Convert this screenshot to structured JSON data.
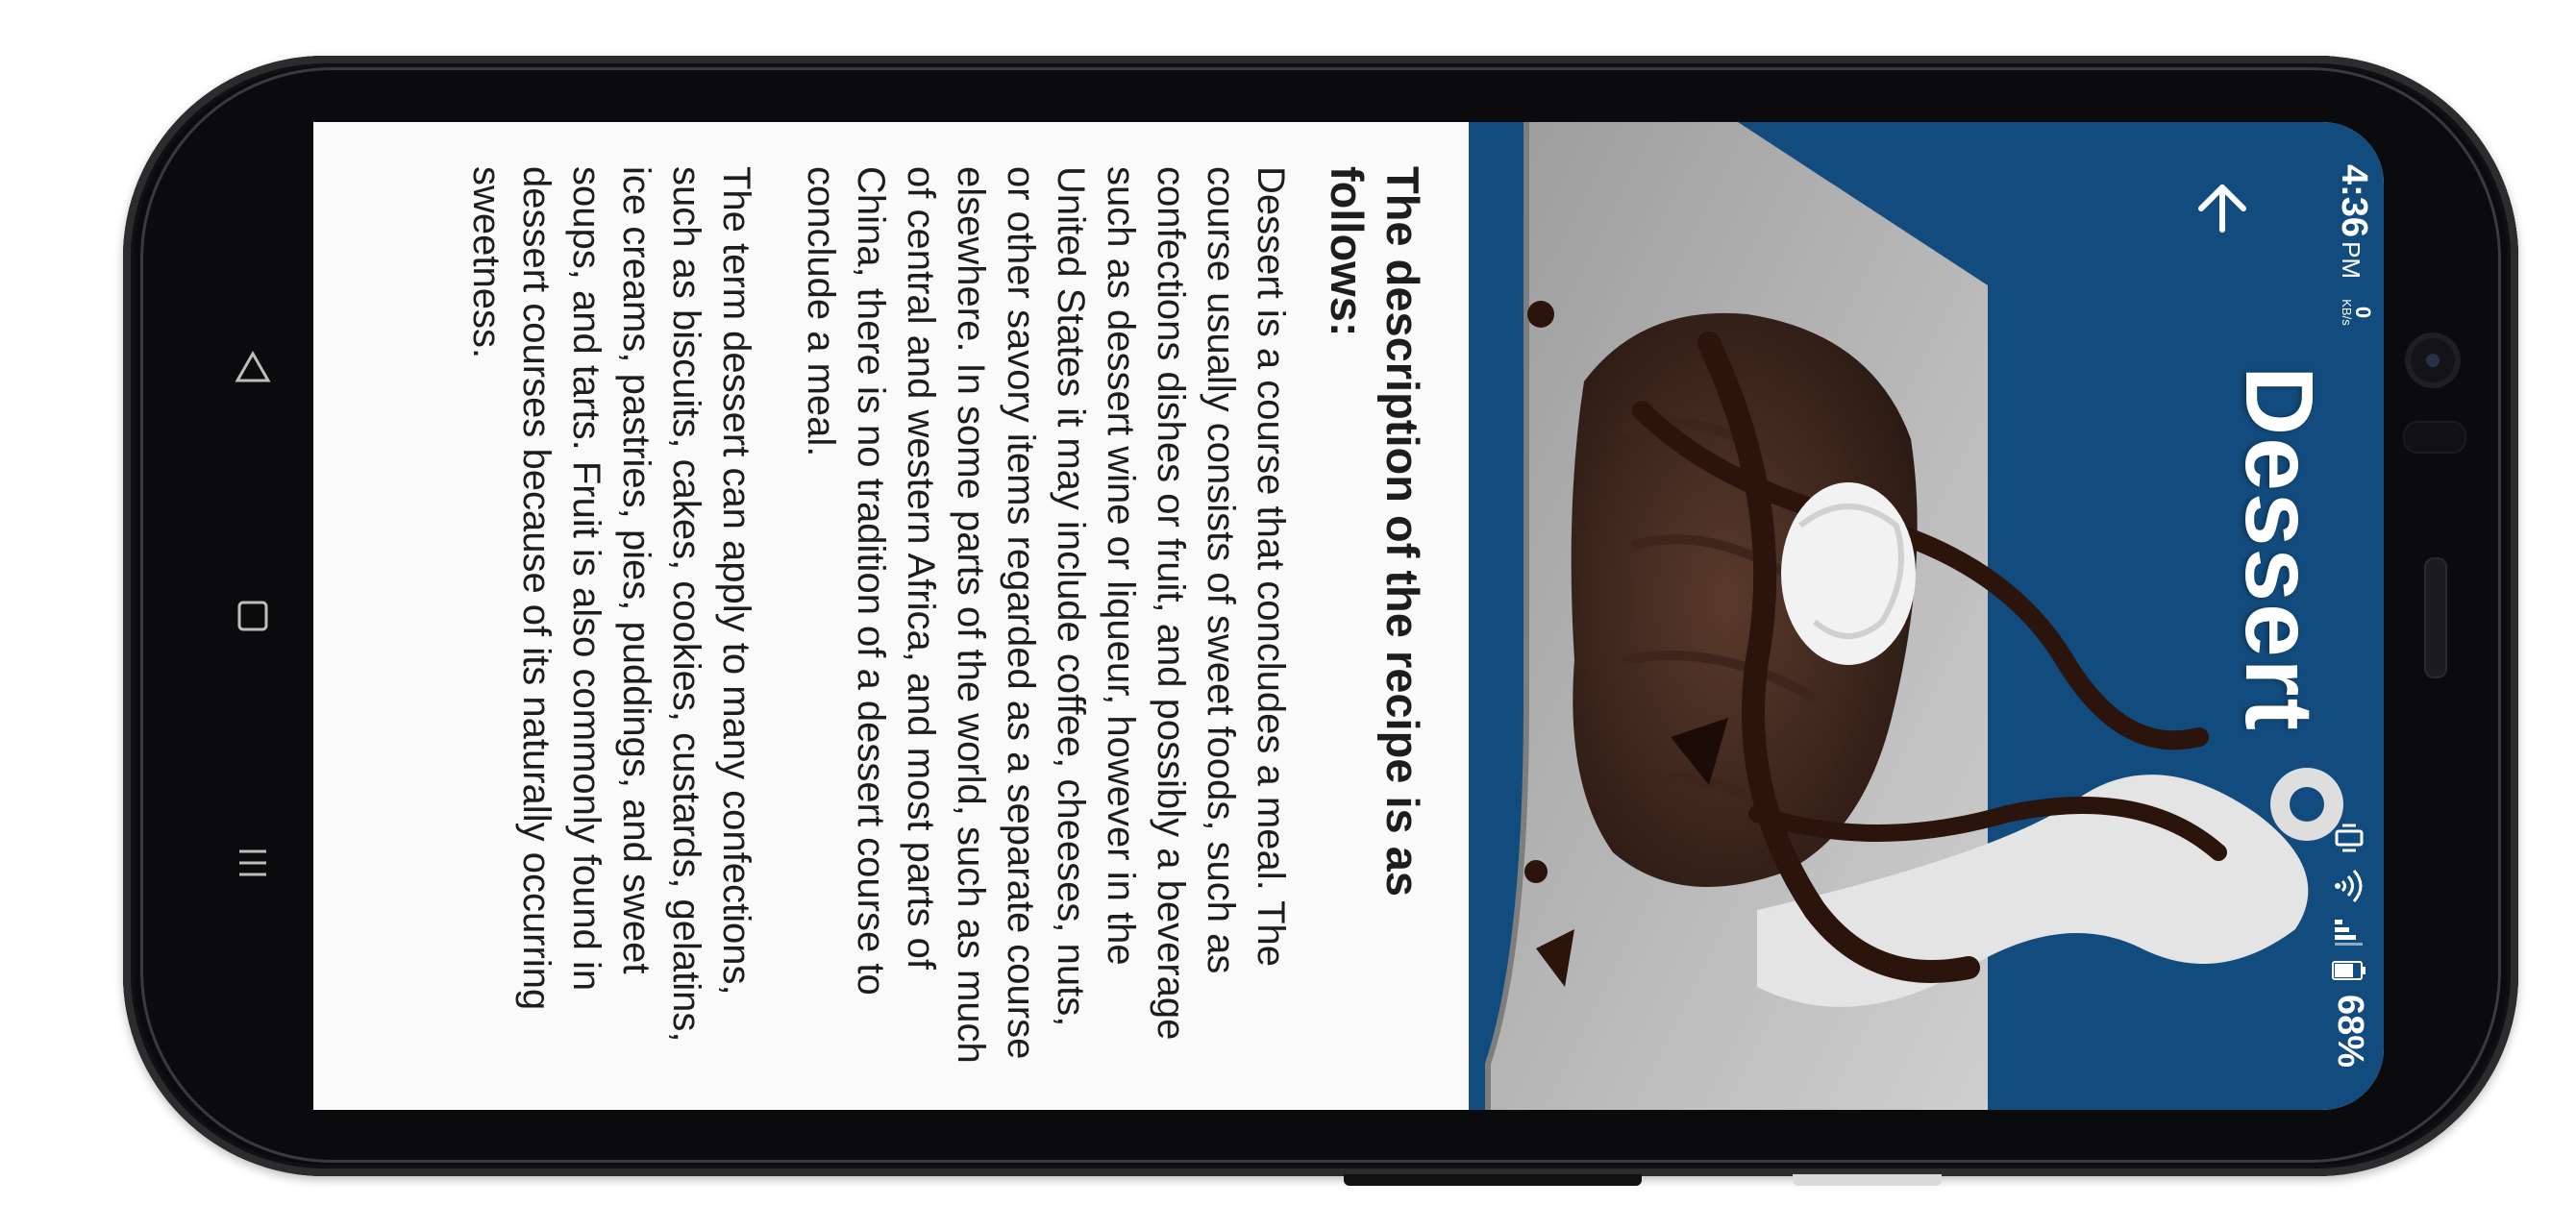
{
  "status_bar": {
    "time": "4:36",
    "ampm": "PM",
    "net_speed": "0",
    "net_unit": "KB/s",
    "battery_percent": "68%",
    "icons": [
      "vibrate-icon",
      "wifi-icon",
      "signal-icon",
      "battery-icon"
    ]
  },
  "header": {
    "title": "Dessert",
    "back_icon": "arrow-back-icon"
  },
  "content": {
    "heading": "The description of the recipe is as follows:",
    "paragraphs": [
      "Dessert is a course that concludes a meal. The course usually consists of sweet foods, such as confections dishes or fruit, and possibly a beverage such as dessert wine or liqueur, however in the United States it may include coffee, cheeses, nuts, or other savory items regarded as a separate course elsewhere. In some parts of the world, such as much of central and western Africa, and most parts of China, there is no tradition of a dessert course to conclude a meal.",
      "The term dessert can apply to many confections, such as biscuits, cakes, cookies, custards, gelatins, ice creams, pastries, pies, puddings, and sweet soups, and tarts. Fruit is also commonly found in dessert courses because of its naturally occurring sweetness."
    ]
  },
  "nav_bar": {
    "buttons": [
      "recents-icon",
      "home-icon",
      "back-triangle-icon"
    ]
  },
  "colors": {
    "hero_background": "#124c7e",
    "screen_background": "#fafafa",
    "text": "#1d1d1d"
  }
}
